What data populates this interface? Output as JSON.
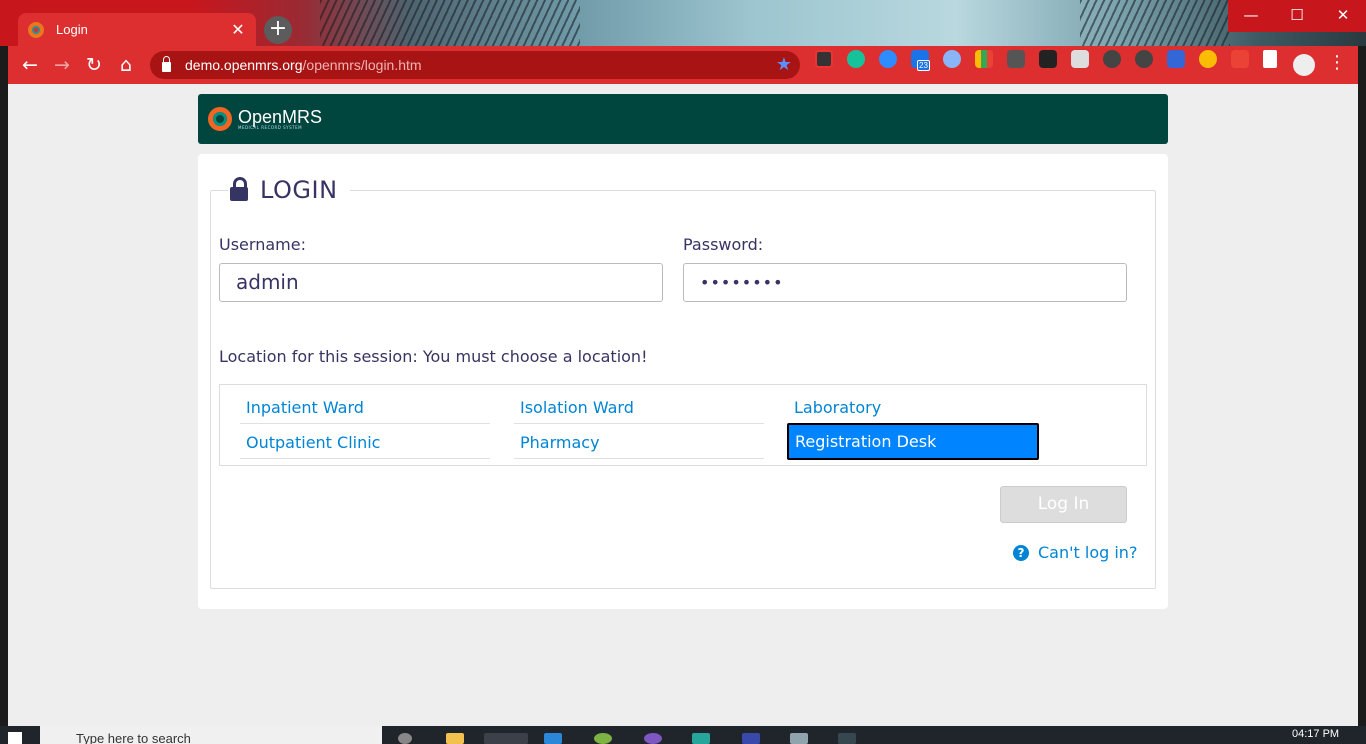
{
  "browser": {
    "tab_title": "Login",
    "tab_close": "✕",
    "new_tab": "+",
    "window": {
      "minimize": "—",
      "maximize": "☐",
      "close": "✕"
    },
    "nav": {
      "back": "←",
      "forward": "→",
      "reload": "↻",
      "home": "⌂"
    },
    "url_host": "demo.openmrs.org",
    "url_path": "/openmrs/login.htm",
    "bookmark": "★",
    "menu": "⋮",
    "ext_badge": "23"
  },
  "header": {
    "brand": "OpenMRS",
    "brand_sub": "MEDICAL RECORD SYSTEM"
  },
  "login": {
    "legend": "LOGIN",
    "username_label": "Username:",
    "username_value": "admin",
    "password_label": "Password:",
    "password_value": "••••••••",
    "location_message": "Location for this session: You must choose a location!",
    "locations": [
      "Inpatient Ward",
      "Isolation Ward",
      "Laboratory",
      "Outpatient Clinic",
      "Pharmacy",
      "Registration Desk"
    ],
    "selected_location": "Registration Desk",
    "login_button": "Log In",
    "help_link": "Can't log in?",
    "help_icon": "?"
  },
  "taskbar": {
    "search_placeholder": "Type here to search",
    "clock": "04:17 PM"
  },
  "colors": {
    "brand": "#00463f",
    "chrome_red": "#dd2f2f",
    "link": "#0084d4",
    "text": "#363463",
    "selected": "#0084ff"
  }
}
